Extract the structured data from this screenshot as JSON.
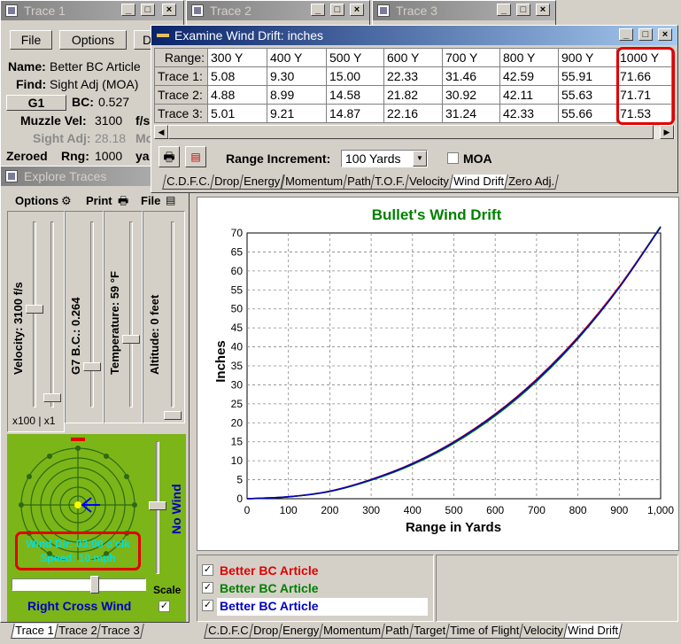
{
  "trace_windows": [
    {
      "title": "Trace 1"
    },
    {
      "title": "Trace 2"
    },
    {
      "title": "Trace 3"
    }
  ],
  "trace1": {
    "menu": {
      "file": "File",
      "options": "Options",
      "d": "D"
    },
    "name_label": "Name:",
    "name_value": "Better BC Article",
    "find_label": "Find:",
    "find_value": "Sight Adj (MOA)",
    "g1_button": "G1",
    "bc_label": "BC:",
    "bc_value": "0.527",
    "muzzle_label": "Muzzle Vel:",
    "muzzle_value": "3100",
    "muzzle_unit": "f/s",
    "sight_label": "Sight Adj:",
    "sight_value": "28.18",
    "sight_extra": "Mo",
    "zeroed_label": "Zeroed",
    "rng_label": "Rng:",
    "rng_value": "1000",
    "rng_unit": "ya"
  },
  "explore": {
    "title": "Explore Traces",
    "options_label": "Options",
    "print_label": "Print",
    "file_label": "File",
    "velocity_label": "Velocity: 3100 f/s",
    "bc_label": "G7 B.C.: 0.264",
    "temp_label": "Temperature: 59 °F",
    "alt_label": "Altitude: 0 feet",
    "scale_label": "x100 | x1",
    "wind_dir": "Wind Dir: 03:00 o'clk",
    "wind_speed": "Speed: 10 mph",
    "no_wind": "No Wind",
    "scale": "Scale",
    "cross_wind": "Right Cross Wind"
  },
  "bottom_tabs_left": [
    "Trace 1",
    "Trace 2",
    "Trace 3"
  ],
  "examine": {
    "title": "Examine Wind Drift:  inches",
    "range_header": "Range:",
    "columns": [
      "300 Y",
      "400 Y",
      "500 Y",
      "600 Y",
      "700 Y",
      "800 Y",
      "900 Y",
      "1000 Y"
    ],
    "rows": [
      {
        "label": "Trace 1:",
        "values": [
          "5.08",
          "9.30",
          "15.00",
          "22.33",
          "31.46",
          "42.59",
          "55.91",
          "71.66"
        ]
      },
      {
        "label": "Trace 2:",
        "values": [
          "4.88",
          "8.99",
          "14.58",
          "21.82",
          "30.92",
          "42.11",
          "55.63",
          "71.71"
        ]
      },
      {
        "label": "Trace 3:",
        "values": [
          "5.01",
          "9.21",
          "14.87",
          "22.16",
          "31.24",
          "42.33",
          "55.66",
          "71.53"
        ]
      }
    ],
    "range_increment_label": "Range Increment:",
    "range_increment_value": "100 Yards",
    "moa_label": "MOA",
    "tabs": [
      "C.D.F.C.",
      "Drop",
      "Energy",
      "Momentum",
      "Path",
      "T.O.F.",
      "Velocity",
      "Wind Drift",
      "Zero Adj."
    ]
  },
  "chart_data": {
    "type": "line",
    "title": "Bullet's Wind Drift",
    "xlabel": "Range in Yards",
    "ylabel": "Inches",
    "xlim": [
      0,
      1000
    ],
    "ylim": [
      0,
      70
    ],
    "xticks": [
      "0",
      "100",
      "200",
      "300",
      "400",
      "500",
      "600",
      "700",
      "800",
      "900",
      "1,000"
    ],
    "yticks": [
      "0",
      "5",
      "10",
      "15",
      "20",
      "25",
      "30",
      "35",
      "40",
      "45",
      "50",
      "55",
      "60",
      "65",
      "70"
    ],
    "grid": true,
    "x": [
      0,
      100,
      200,
      300,
      400,
      500,
      600,
      700,
      800,
      900,
      1000
    ],
    "series": [
      {
        "name": "Better BC Article",
        "color": "#e00000",
        "values": [
          0,
          0.5,
          2.0,
          5.08,
          9.3,
          15.0,
          22.33,
          31.46,
          42.59,
          55.91,
          71.66
        ]
      },
      {
        "name": "Better BC Article",
        "color": "#008000",
        "values": [
          0,
          0.5,
          1.9,
          4.88,
          8.99,
          14.58,
          21.82,
          30.92,
          42.11,
          55.63,
          71.71
        ]
      },
      {
        "name": "Better BC Article",
        "color": "#0000c0",
        "values": [
          0,
          0.5,
          1.95,
          5.01,
          9.21,
          14.87,
          22.16,
          31.24,
          42.33,
          55.66,
          71.53
        ]
      }
    ]
  },
  "bottom_tabs_right": [
    "C.D.F.C",
    "Drop",
    "Energy",
    "Momentum",
    "Path",
    "Target",
    "Time of Flight",
    "Velocity",
    "Wind Drift"
  ]
}
